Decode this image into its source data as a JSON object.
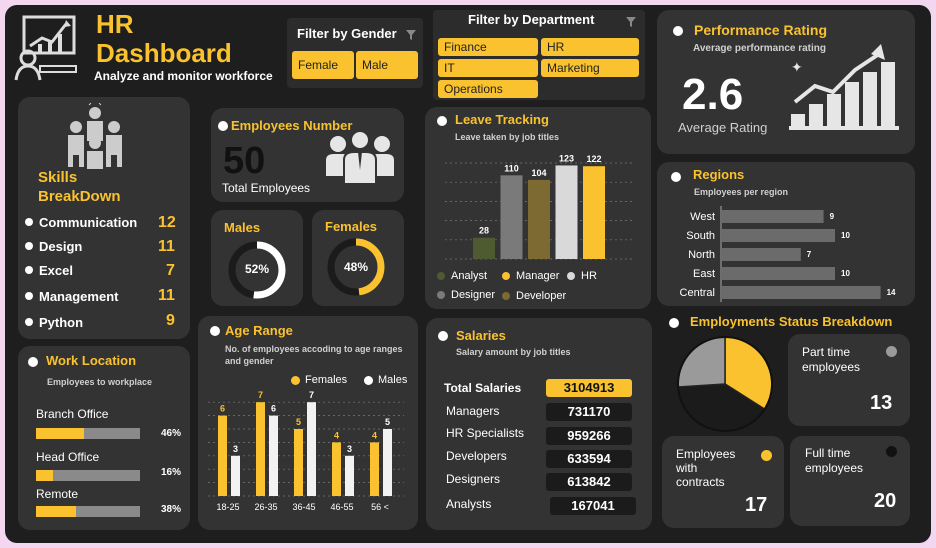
{
  "header": {
    "title_line1": "HR",
    "title_line2": "Dashboard",
    "subtitle": "Analyze and monitor workforce"
  },
  "gender_filter": {
    "title": "Filter by Gender",
    "options": [
      "Female",
      "Male"
    ]
  },
  "department_filter": {
    "title": "Filter by Department",
    "options": [
      "Finance",
      "HR",
      "IT",
      "Marketing",
      "Operations"
    ]
  },
  "performance": {
    "title": "Performance Rating",
    "subtitle": "Average performance rating",
    "value": "2.6",
    "label": "Average Rating"
  },
  "skills": {
    "title_line1": "Skills",
    "title_line2": "BreakDown",
    "items": [
      {
        "label": "Communication",
        "value": "12"
      },
      {
        "label": "Design",
        "value": "11"
      },
      {
        "label": "Excel",
        "value": "7"
      },
      {
        "label": "Management",
        "value": "11"
      },
      {
        "label": "Python",
        "value": "9"
      }
    ]
  },
  "employees": {
    "title": "Employees Number",
    "value": "50",
    "label": "Total Employees"
  },
  "males": {
    "title": "Males",
    "percent": 52,
    "label": "52%"
  },
  "females": {
    "title": "Females",
    "percent": 48,
    "label": "48%"
  },
  "leave": {
    "title": "Leave Tracking",
    "subtitle": "Leave taken by job titles",
    "legend": [
      {
        "name": "Analyst",
        "color": "#4e5a30"
      },
      {
        "name": "Manager",
        "color": "#f9c22e"
      },
      {
        "name": "HR",
        "color": "#d9d9d9"
      },
      {
        "name": "Designer",
        "color": "#7a7a7a"
      },
      {
        "name": "Developer",
        "color": "#7d6a32"
      }
    ]
  },
  "regions": {
    "title": "Regions",
    "subtitle": "Employees per region"
  },
  "work_location": {
    "title": "Work Location",
    "subtitle": "Employees to workplace",
    "items": [
      {
        "label": "Branch Office",
        "percent": 46,
        "value": "46%"
      },
      {
        "label": "Head Office",
        "percent": 16,
        "value": "16%"
      },
      {
        "label": "Remote",
        "percent": 38,
        "value": "38%"
      }
    ]
  },
  "age_range": {
    "title": "Age Range",
    "subtitle": "No. of employees accoding to age ranges and gender",
    "legend": [
      "Females",
      "Males"
    ]
  },
  "salaries": {
    "title": "Salaries",
    "subtitle": "Salary amount by job titles",
    "total_label": "Total Salaries",
    "total_value": "3104913",
    "rows": [
      {
        "label": "Managers",
        "value": "731170"
      },
      {
        "label": "HR Specialists",
        "value": "959266"
      },
      {
        "label": "Developers",
        "value": "633594"
      },
      {
        "label": "Designers",
        "value": "613842"
      },
      {
        "label": "Analysts",
        "value": "167041"
      }
    ]
  },
  "employment_status": {
    "title": "Employments Status Breakdown",
    "part_time": {
      "label": "Part time employees",
      "value": "13"
    },
    "contracts": {
      "label": "Employees with contracts",
      "value": "17"
    },
    "full_time": {
      "label": "Full time employees",
      "value": "20"
    }
  },
  "colors": {
    "accent": "#f9c22e",
    "card": "#333333",
    "background": "#1e1e1e",
    "page": "#f3d6f0"
  },
  "chart_data": [
    {
      "type": "bar",
      "id": "leave",
      "categories": [
        "Analyst",
        "Designer",
        "Developer",
        "HR",
        "Manager"
      ],
      "values": [
        28,
        110,
        104,
        123,
        122
      ],
      "colors": [
        "#4e5a30",
        "#7a7a7a",
        "#7d6a32",
        "#d9d9d9",
        "#f9c22e"
      ]
    },
    {
      "type": "bar",
      "id": "regions",
      "orientation": "horizontal",
      "categories": [
        "West",
        "South",
        "North",
        "East",
        "Central"
      ],
      "values": [
        9,
        10,
        7,
        10,
        14
      ]
    },
    {
      "type": "bar",
      "id": "age",
      "categories": [
        "18-25",
        "26-35",
        "36-45",
        "46-55",
        "56 <"
      ],
      "series": [
        {
          "name": "Females",
          "values": [
            6,
            7,
            5,
            4,
            4
          ],
          "color": "#f9c22e"
        },
        {
          "name": "Males",
          "values": [
            3,
            6,
            7,
            3,
            5
          ],
          "color": "#f2f2f2"
        }
      ]
    },
    {
      "type": "pie",
      "id": "employment",
      "categories": [
        "Employees with contracts",
        "Full time employees",
        "Part time employees"
      ],
      "values": [
        17,
        20,
        13
      ],
      "colors": [
        "#f9c22e",
        "#1b1b1b",
        "#9a9a9a"
      ]
    }
  ]
}
